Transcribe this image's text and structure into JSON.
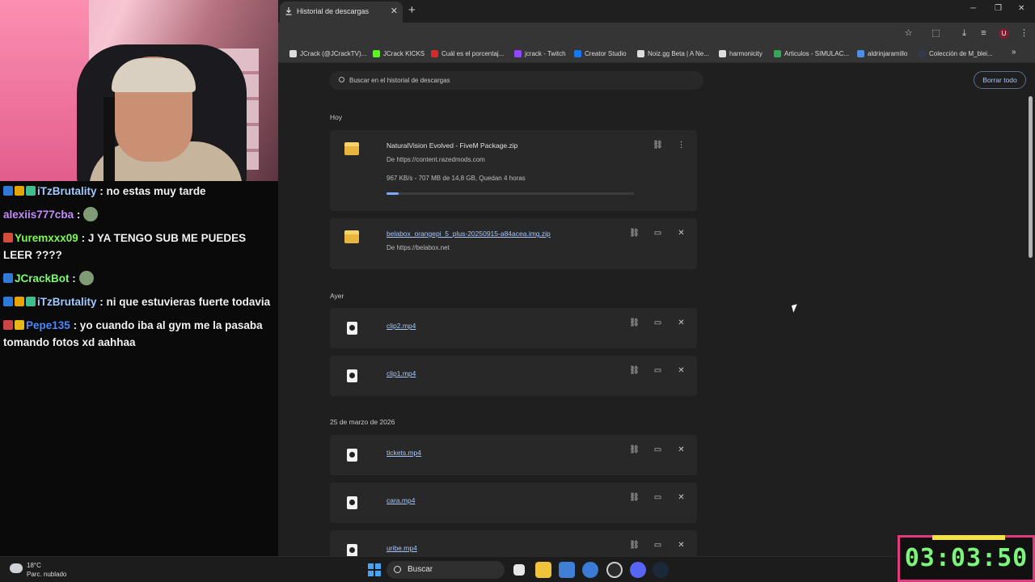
{
  "chat": [
    {
      "user": "iTzBrutality",
      "color": "#9ecbff",
      "message": ": no estas muy tarde",
      "badges": [
        "#2f7ad8",
        "#e8a20a",
        "#3fbf8f"
      ]
    },
    {
      "user": "alexiis777cba",
      "color": "#c78cff",
      "message": ":",
      "badges": [],
      "emote": true
    },
    {
      "user": "Yuremxxx09",
      "color": "#76ff4f",
      "message": ": J YA TENGO SUB ME PUEDES LEER ????",
      "badges": [
        "#d34d3a"
      ]
    },
    {
      "user": "JCrackBot",
      "color": "#7cfc6d",
      "message": ":",
      "badges": [
        "#2f7ad8"
      ],
      "emote": true
    },
    {
      "user": "iTzBrutality",
      "color": "#9ecbff",
      "message": ": ni que estuvieras fuerte todavia",
      "badges": [
        "#2f7ad8",
        "#e8a20a",
        "#3fbf8f"
      ]
    },
    {
      "user": "Pepe135",
      "color": "#4a89ff",
      "message": ": yo cuando iba al gym me la pasaba tomando fotos xd aahhaa",
      "badges": [
        "#c44",
        "#e8b81a"
      ]
    }
  ],
  "tab": {
    "title": "Historial de descargas"
  },
  "bookmarks": [
    {
      "label": "JCrack (@JCrackTV)...",
      "color": "#dddddd"
    },
    {
      "label": "JCrack KICKS",
      "color": "#53fc18"
    },
    {
      "label": "Cuál es el porcentaj...",
      "color": "#d42b2b"
    },
    {
      "label": "jcrack - Twitch",
      "color": "#9146ff"
    },
    {
      "label": "Creator Studio",
      "color": "#1877f2"
    },
    {
      "label": "Noiz.gg Beta | A Ne...",
      "color": "#dddddd"
    },
    {
      "label": "harmonicity",
      "color": "#dddddd"
    },
    {
      "label": "Articulos - SIMULAC...",
      "color": "#34a853"
    },
    {
      "label": "aldrinjaramillo",
      "color": "#4f8fe3"
    },
    {
      "label": "Colección de M_blei...",
      "color": "#333a48"
    }
  ],
  "downloads": {
    "search_placeholder": "Buscar en el historial de descargas",
    "clear_all": "Borrar todo",
    "groups": [
      {
        "date": "Hoy"
      },
      {
        "date": "Ayer"
      },
      {
        "date": "25 de marzo de 2026"
      }
    ],
    "items": [
      {
        "name": "NaturalVision Evolved - FiveM Package.zip",
        "source": "De https://content.razedmods.com",
        "status": "967 KB/s - 707 MB de 14,8 GB, Quedan 4 horas",
        "progress": 0.048,
        "icon": "folder-zip-icon",
        "in_progress": true
      },
      {
        "name": "belabox_orangepi_5_plus-20250915-a84acea.img.zip",
        "source": "De https://belabox.net",
        "icon": "folder-zip-icon"
      },
      {
        "name": "clip2.mp4",
        "icon": "video-file-icon"
      },
      {
        "name": "clip1.mp4",
        "icon": "video-file-icon"
      },
      {
        "name": "tickets.mp4",
        "icon": "video-file-icon"
      },
      {
        "name": "cara.mp4",
        "icon": "video-file-icon"
      },
      {
        "name": "uribe.mp4",
        "icon": "video-file-icon"
      }
    ]
  },
  "taskbar": {
    "temperature": "18°C",
    "weather": "Parc. nublado",
    "search": "Buscar"
  },
  "timer": {
    "value": "03:03:50"
  }
}
